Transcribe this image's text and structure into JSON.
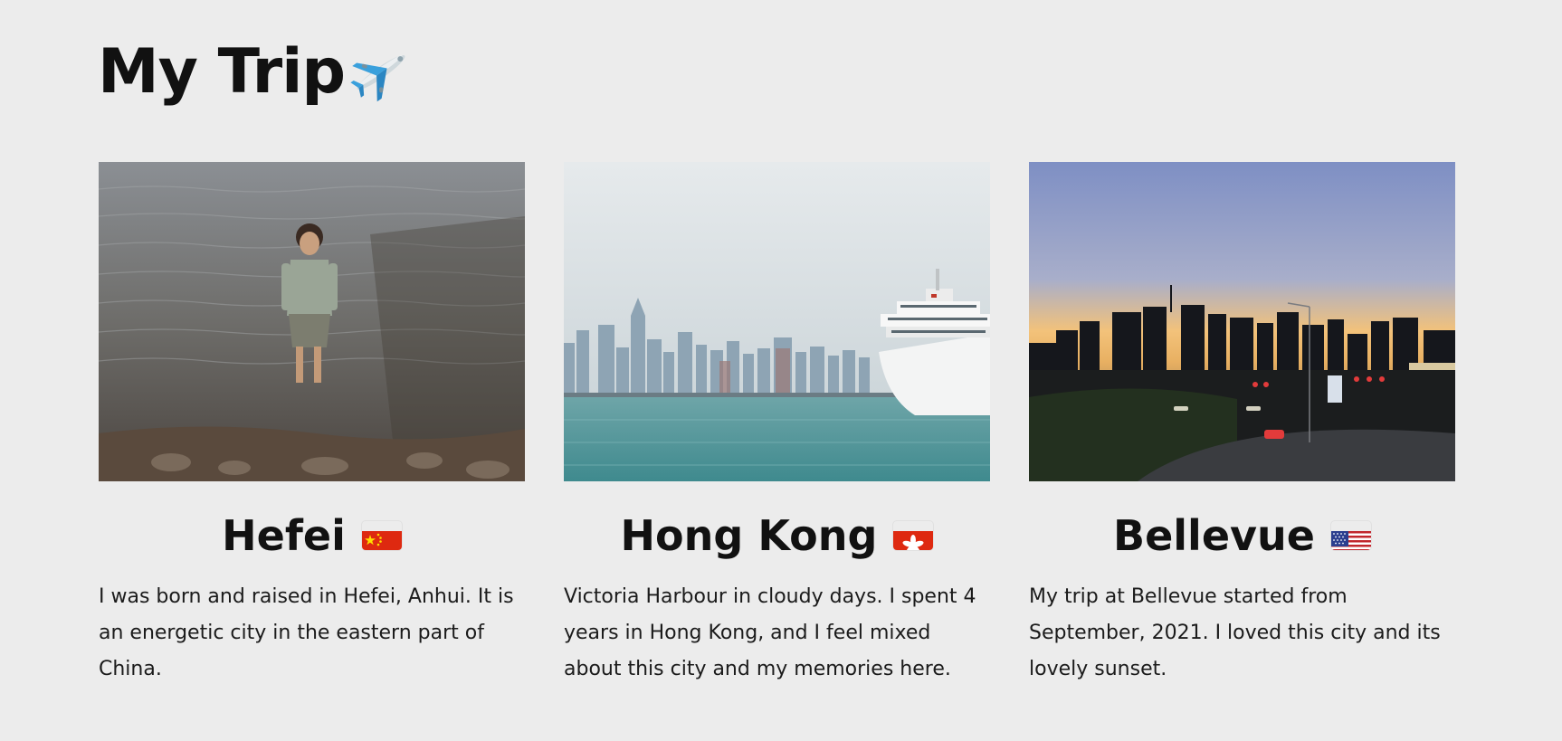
{
  "page": {
    "title": "My Trip",
    "title_icon": "airplane-icon"
  },
  "cards": [
    {
      "city": "Hefei",
      "flag_icon": "china-flag-icon",
      "description": "I was born and raised in Hefei, Anhui. It is an energetic city in the eastern part of China."
    },
    {
      "city": "Hong Kong",
      "flag_icon": "hong-kong-flag-icon",
      "description": "Victoria Harbour in cloudy days. I spent 4 years in Hong Kong, and I feel mixed about this city and my memories here."
    },
    {
      "city": "Bellevue",
      "flag_icon": "usa-flag-icon",
      "description": "My trip at Bellevue started from September, 2021. I loved this city and its lovely sunset."
    }
  ],
  "colors": {
    "background": "#ececec",
    "text": "#111111"
  }
}
